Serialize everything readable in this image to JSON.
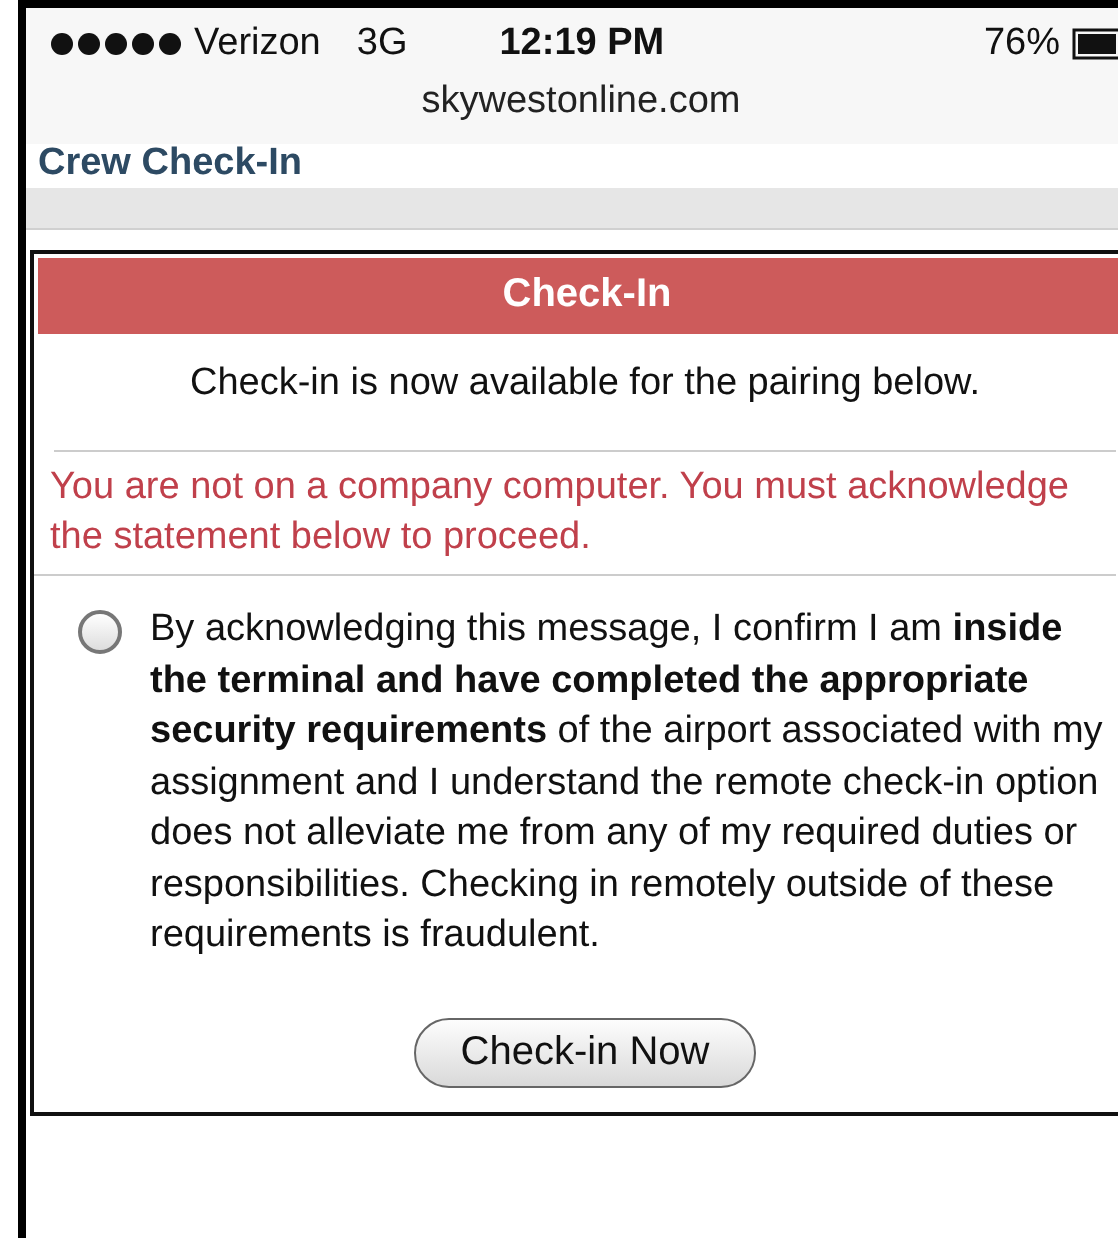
{
  "status_bar": {
    "carrier": "Verizon",
    "network": "3G",
    "time": "12:19 PM",
    "battery": "76%"
  },
  "address_bar": {
    "url": "skywestonline.com"
  },
  "page_header": {
    "title": "Crew Check-In"
  },
  "panel": {
    "title": "Check-In",
    "notice": "Check-in is now available for the pairing below.",
    "warning": "You are not on a company computer. You must acknowledge the statement below to proceed.",
    "acknowledgement": {
      "checked": false,
      "text": "By acknowledging this message, I confirm I am **inside the terminal and have completed the appropriate security requirements** of the airport associated with my assignment and I understand the remote check-in option does not alleviate me from any of my required duties or responsibilities. Checking in remotely outside of these requirements is fraudulent."
    },
    "button": "Check-in Now"
  }
}
